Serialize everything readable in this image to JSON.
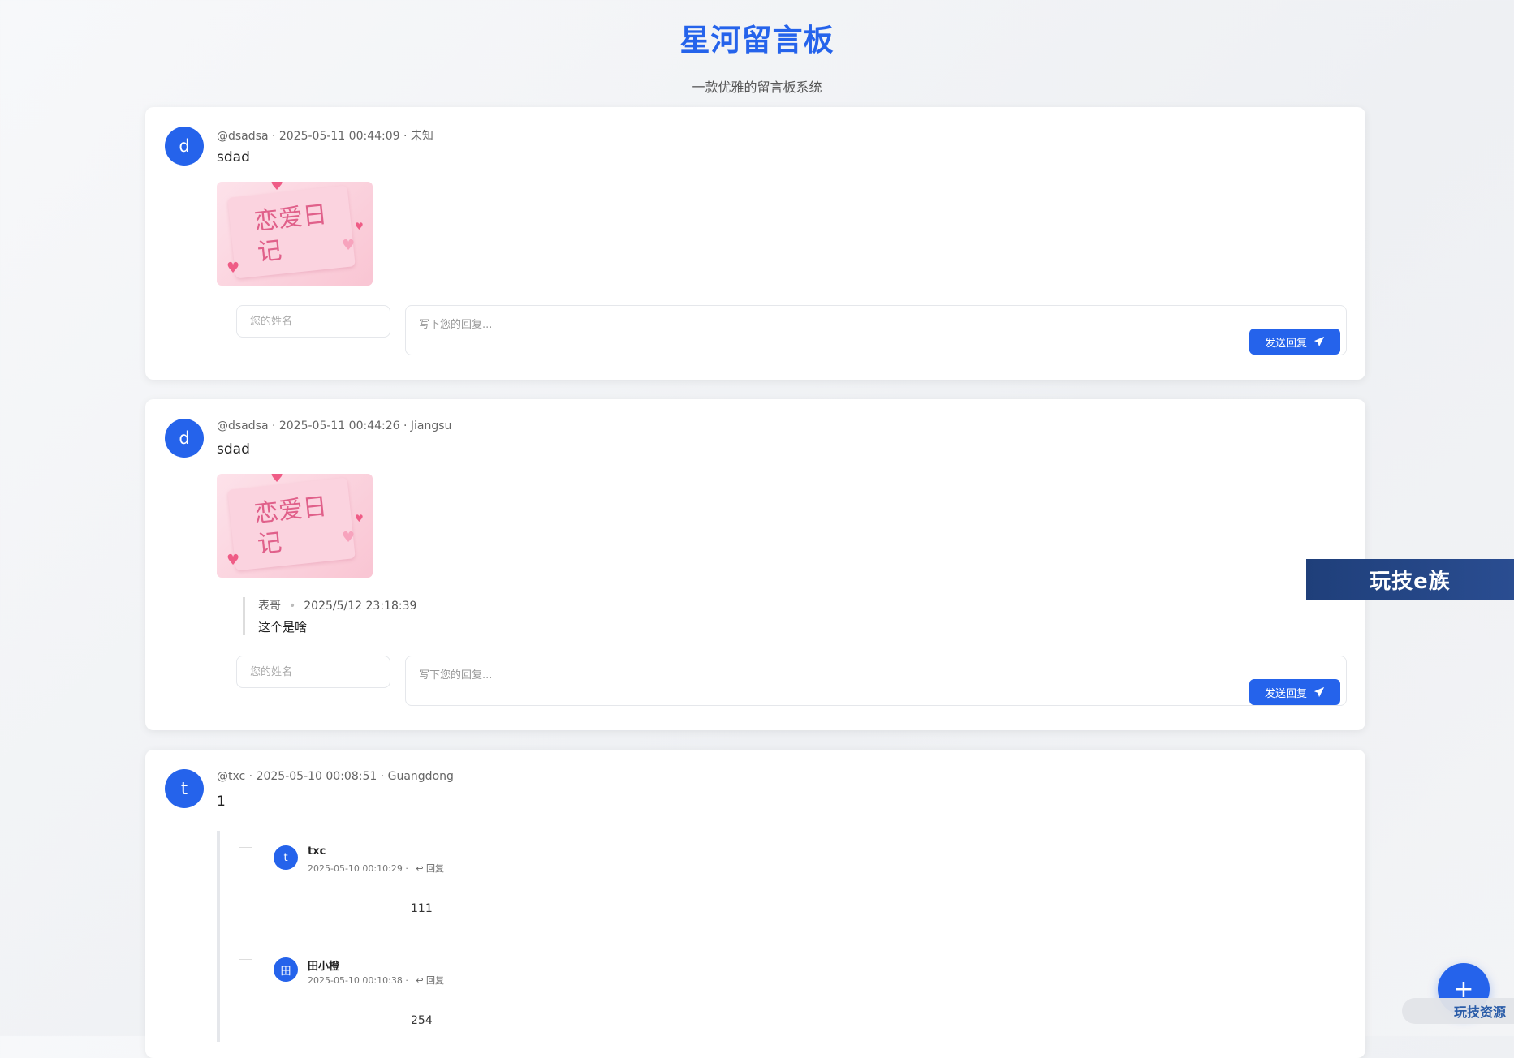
{
  "header": {
    "title": "星河留言板",
    "subtitle": "一款优雅的留言板系统"
  },
  "messages": [
    {
      "avatar": "d",
      "meta": "@dsadsa · 2025-05-11 00:44:09 · 未知",
      "content": "sdad",
      "sticker_text": "恋爱日记",
      "reply_form": {
        "name_placeholder": "您的姓名",
        "text_placeholder": "写下您的回复...",
        "send_label": "发送回复"
      }
    },
    {
      "avatar": "d",
      "meta": "@dsadsa · 2025-05-11 00:44:26 · Jiangsu",
      "content": "sdad",
      "sticker_text": "恋爱日记",
      "replies": [
        {
          "author": "表哥",
          "time": "2025/5/12 23:18:39",
          "text": "这个是啥"
        }
      ],
      "reply_form": {
        "name_placeholder": "您的姓名",
        "text_placeholder": "写下您的回复...",
        "send_label": "发送回复"
      }
    },
    {
      "avatar": "t",
      "meta": "@txc · 2025-05-10 00:08:51 · Guangdong",
      "content": "1",
      "thread": [
        {
          "avatar": "t",
          "name": "txc",
          "time": "2025-05-10 00:10:29",
          "reply_label": "回复",
          "text": "111"
        },
        {
          "avatar": "田",
          "name": "田小橙",
          "time": "2025-05-10 00:10:38",
          "reply_label": "回复",
          "text": "254"
        }
      ]
    }
  ],
  "banner": "玩技e族",
  "fab_icon": "plus-icon",
  "watermark": "玩技资源",
  "colors": {
    "accent": "#2563eb",
    "banner": "#2a4d91"
  }
}
